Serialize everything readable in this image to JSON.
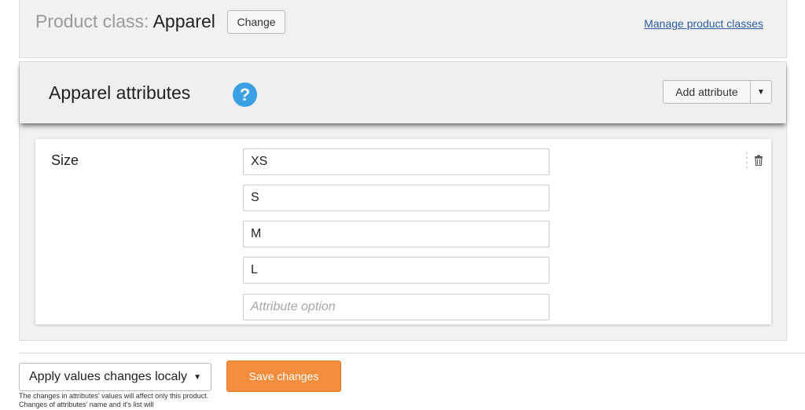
{
  "product_class": {
    "label": "Product class:",
    "value": "Apparel",
    "change_label": "Change",
    "manage_link": "Manage product classes"
  },
  "attributes_panel": {
    "title": "Apparel attributes",
    "help_glyph": "?",
    "add_attribute_label": "Add attribute",
    "caret_glyph": "▼"
  },
  "attribute": {
    "name": "Size",
    "options": [
      "XS",
      "S",
      "M",
      "L"
    ],
    "new_option_placeholder": "Attribute option"
  },
  "footer": {
    "apply_select_value": "Apply values changes localy",
    "apply_caret": "▼",
    "save_label": "Save changes",
    "help_text": "The changes in attributes' values will affect only this product. Changes of attributes' name and it's list will"
  },
  "colors": {
    "accent_orange": "#f28e3d",
    "link_blue": "#2b5c9e",
    "help_blue": "#3a9fe3"
  },
  "icons": [
    "help-icon",
    "dropdown-caret-icon",
    "drag-handle-icon",
    "trash-icon"
  ]
}
